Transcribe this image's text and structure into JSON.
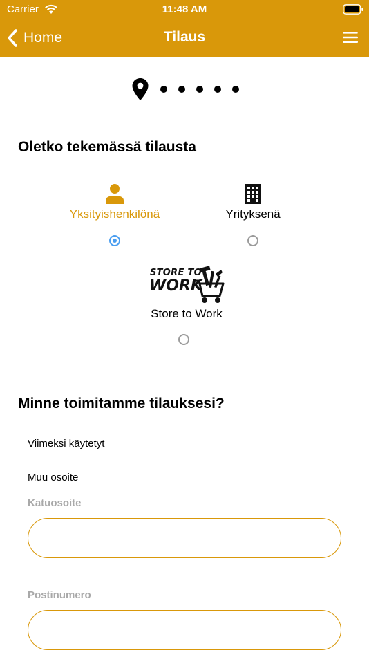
{
  "status_bar": {
    "carrier": "Carrier",
    "time": "11:48 AM"
  },
  "nav": {
    "back_label": "Home",
    "title": "Tilaus",
    "back_icon": "chevron-left-icon",
    "menu_icon": "hamburger-menu-icon"
  },
  "progress": {
    "current_step": 1,
    "total_steps": 6,
    "current_icon": "location-pin-icon"
  },
  "customer_type": {
    "heading": "Oletko tekemässä tilausta",
    "options": [
      {
        "label": "Yksityishenkilönä",
        "icon": "person-icon",
        "selected": true
      },
      {
        "label": "Yrityksenä",
        "icon": "building-icon",
        "selected": false
      },
      {
        "label": "Store to Work",
        "logo_text": [
          "STORE TO",
          "WORK"
        ],
        "icon": "store-to-work-logo",
        "selected": false
      }
    ]
  },
  "delivery": {
    "heading": "Minne toimitamme tilauksesi?",
    "recent_label": "Viimeksi käytetyt",
    "other_label": "Muu osoite",
    "street_label": "Katuosoite",
    "street_value": "",
    "postal_label": "Postinumero",
    "postal_value": ""
  },
  "colors": {
    "accent": "#d9980a",
    "radio_selected": "#4a9ef0",
    "field_label": "#a9a9a9"
  }
}
